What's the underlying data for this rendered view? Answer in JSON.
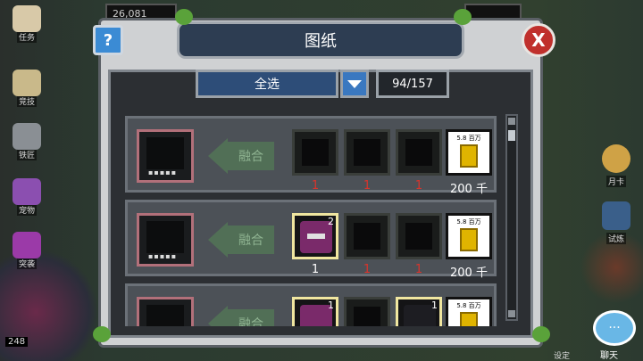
{
  "hud": {
    "gold": "26,081",
    "level": "248"
  },
  "left_menu": [
    {
      "label": "任务",
      "icon": "scroll-icon",
      "color": "#d8c9a8"
    },
    {
      "label": "竞技",
      "icon": "swords-icon",
      "color": "#c9b98a"
    },
    {
      "label": "铁匠",
      "icon": "anvil-icon",
      "color": "#8a8f94"
    },
    {
      "label": "宠物",
      "icon": "pet-icon",
      "color": "#8b4fb0"
    },
    {
      "label": "突袭",
      "icon": "crystal-icon",
      "color": "#9b3aa8"
    }
  ],
  "right_menu": [
    {
      "label": "月卡",
      "icon": "crown-icon",
      "color": "#cfa246"
    },
    {
      "label": "试炼",
      "icon": "beast-icon",
      "color": "#3a5f8a"
    }
  ],
  "dialog": {
    "title": "图纸",
    "help_label": "?",
    "close_label": "X",
    "filter_value": "全选",
    "count": "94/157"
  },
  "recipes": [
    {
      "fuse_label": "融合",
      "slots": [
        {
          "state": "locked",
          "qty": "1",
          "qty_color": "red"
        },
        {
          "state": "locked",
          "qty": "1",
          "qty_color": "red"
        },
        {
          "state": "locked",
          "qty": "1",
          "qty_color": "red"
        }
      ],
      "cost_label": "5.8 百万",
      "price": "200 千"
    },
    {
      "fuse_label": "融合",
      "slots": [
        {
          "state": "owned",
          "badge": "2",
          "qty": "1",
          "qty_color": "white",
          "monster": "purple"
        },
        {
          "state": "locked",
          "qty": "1",
          "qty_color": "red"
        },
        {
          "state": "locked",
          "qty": "1",
          "qty_color": "red"
        }
      ],
      "cost_label": "5.8 百万",
      "price": "200 千"
    },
    {
      "fuse_label": "融合",
      "slots": [
        {
          "state": "owned",
          "badge": "1",
          "qty": "",
          "qty_color": "white",
          "monster": "purple"
        },
        {
          "state": "locked",
          "qty": "",
          "qty_color": "red"
        },
        {
          "state": "owned",
          "badge": "1",
          "qty": "",
          "qty_color": "white",
          "monster": "black"
        }
      ],
      "cost_label": "5.8 百万",
      "price": ""
    }
  ],
  "chat_label": "聊天",
  "settings_label": "设定"
}
